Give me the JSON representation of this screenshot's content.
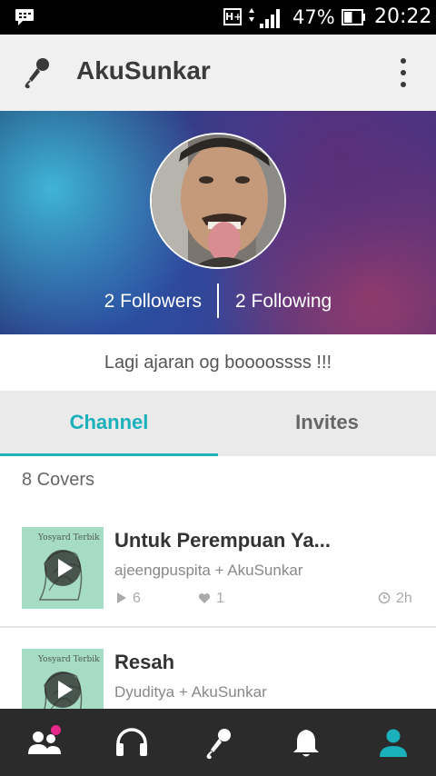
{
  "status_bar": {
    "network_type": "H+",
    "battery_percent": "47%",
    "battery_level": 0.47,
    "time": "20:22",
    "icons": [
      "bbm-icon",
      "signal-icon",
      "battery-icon"
    ]
  },
  "app_bar": {
    "title": "AkuSunkar",
    "icons": [
      "microphone-icon",
      "more-vert-icon"
    ]
  },
  "profile": {
    "followers": "2 Followers",
    "following": "2 Following",
    "bio": "Lagi ajaran og boooossss !!!"
  },
  "tabs": [
    {
      "label": "Channel",
      "selected": true
    },
    {
      "label": "Invites",
      "selected": false
    }
  ],
  "covers_count": "8 Covers",
  "covers": [
    {
      "title": "Untuk Perempuan Ya...",
      "artists": "ajeengpuspita + AkuSunkar",
      "plays": "6",
      "likes": "1",
      "age": "2h"
    },
    {
      "title": "Resah",
      "artists": "Dyuditya + AkuSunkar"
    }
  ],
  "bottom_nav": [
    {
      "icon": "people-icon",
      "active": false,
      "badge": true
    },
    {
      "icon": "headphones-icon",
      "active": false
    },
    {
      "icon": "microphone-icon",
      "active": false
    },
    {
      "icon": "bell-icon",
      "active": false
    },
    {
      "icon": "profile-icon",
      "active": true
    }
  ],
  "colors": {
    "accent": "#1ab0bc",
    "bottom_nav_bg": "#2b2b2b",
    "badge": "#e8278a",
    "app_bar_bg": "#f0f0f0"
  }
}
